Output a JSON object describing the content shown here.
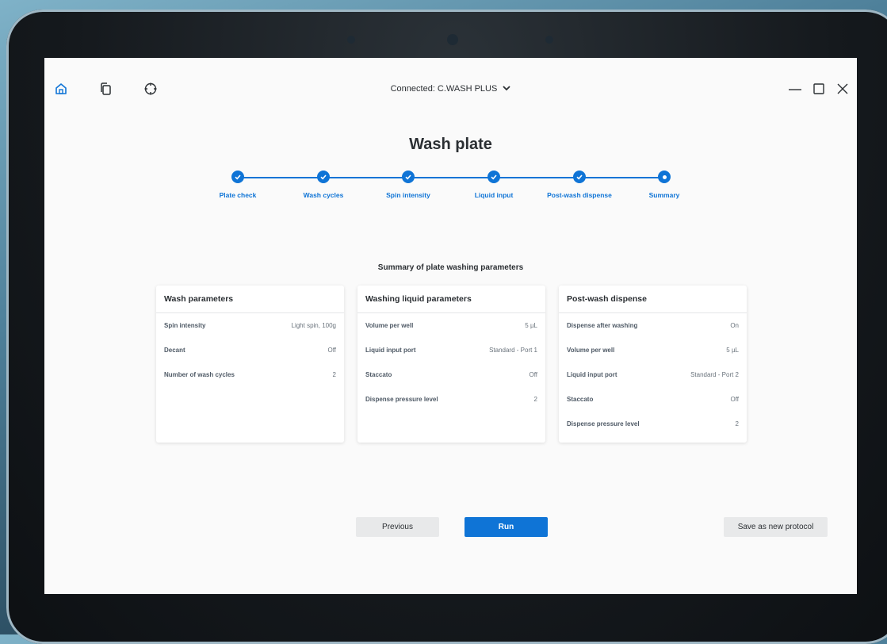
{
  "topbar": {
    "connection_label": "Connected: C.WASH PLUS",
    "icons": [
      "home-icon",
      "documents-icon",
      "crosshair-icon"
    ],
    "window_controls": [
      "minimize-icon",
      "maximize-icon",
      "close-icon"
    ]
  },
  "page": {
    "title": "Wash plate",
    "summary_title": "Summary of plate washing parameters"
  },
  "steps": [
    {
      "label": "Plate check",
      "state": "done"
    },
    {
      "label": "Wash cycles",
      "state": "done"
    },
    {
      "label": "Spin intensity",
      "state": "done"
    },
    {
      "label": "Liquid input",
      "state": "done"
    },
    {
      "label": "Post-wash dispense",
      "state": "done"
    },
    {
      "label": "Summary",
      "state": "current"
    }
  ],
  "cards": [
    {
      "title": "Wash parameters",
      "rows": [
        {
          "key": "Spin intensity",
          "value": "Light spin, 100g"
        },
        {
          "key": "Decant",
          "value": "Off"
        },
        {
          "key": "Number of wash cycles",
          "value": "2"
        }
      ]
    },
    {
      "title": "Washing liquid parameters",
      "rows": [
        {
          "key": "Volume per well",
          "value": "5 µL"
        },
        {
          "key": "Liquid input port",
          "value": "Standard - Port 1"
        },
        {
          "key": "Staccato",
          "value": "Off"
        },
        {
          "key": "Dispense pressure level",
          "value": "2"
        }
      ]
    },
    {
      "title": "Post-wash dispense",
      "rows": [
        {
          "key": "Dispense after washing",
          "value": "On"
        },
        {
          "key": "Volume per well",
          "value": "5 µL"
        },
        {
          "key": "Liquid input port",
          "value": "Standard - Port 2"
        },
        {
          "key": "Staccato",
          "value": "Off"
        },
        {
          "key": "Dispense pressure level",
          "value": "2"
        }
      ]
    }
  ],
  "buttons": {
    "previous": "Previous",
    "run": "Run",
    "save": "Save as new protocol"
  },
  "colors": {
    "accent": "#0f74d6",
    "secondary_button": "#e8e9ea",
    "screen_bg": "#fafafa"
  }
}
